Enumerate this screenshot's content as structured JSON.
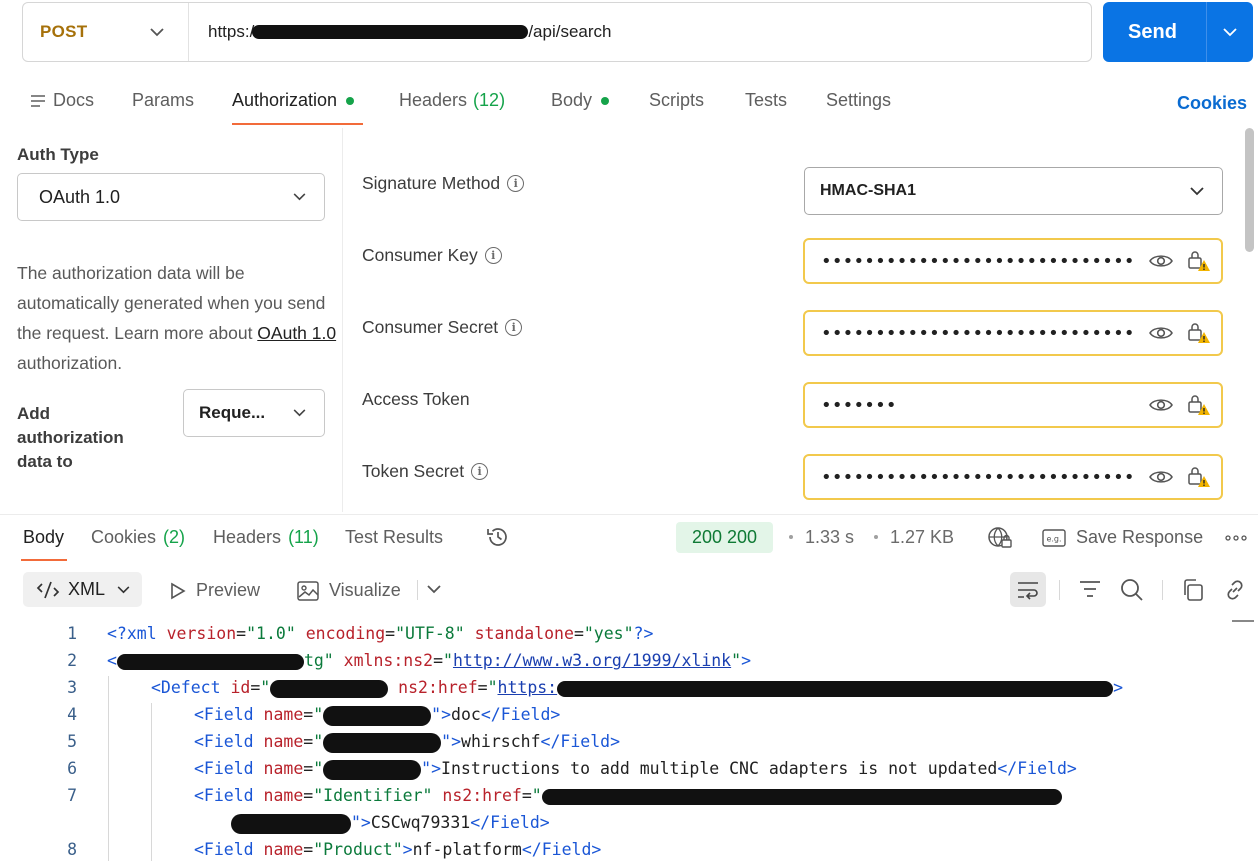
{
  "request": {
    "method": "POST",
    "url_prefix": "https:/",
    "url_suffix": "/api/search",
    "send_label": "Send"
  },
  "req_tabs": [
    {
      "label": "Docs"
    },
    {
      "label": "Params"
    },
    {
      "label": "Authorization"
    },
    {
      "label": "Headers",
      "count": "(12)"
    },
    {
      "label": "Body"
    },
    {
      "label": "Scripts"
    },
    {
      "label": "Tests"
    },
    {
      "label": "Settings"
    }
  ],
  "cookies_link": "Cookies",
  "auth": {
    "type_label": "Auth Type",
    "type_value": "OAuth 1.0",
    "desc_part1": "The authorization data will be automatically generated when you send the request. Learn more about ",
    "desc_link": "OAuth 1.0",
    "desc_part2": " authorization.",
    "add_label": "Add authorization data to",
    "add_value": "Reque..."
  },
  "fields": {
    "signature_method": {
      "label": "Signature Method",
      "value": "HMAC-SHA1"
    },
    "consumer_key": {
      "label": "Consumer Key",
      "value": "••••••••••••••••••••••••••••••••"
    },
    "consumer_secret": {
      "label": "Consumer Secret",
      "value": "••••••••••••••••••••••••••••••••"
    },
    "access_token": {
      "label": "Access Token",
      "value": "•••••••"
    },
    "token_secret": {
      "label": "Token Secret",
      "value": "••••••••••••••••••••••••••••••••"
    }
  },
  "resp_tabs": [
    {
      "label": "Body"
    },
    {
      "label": "Cookies",
      "count": "(2)"
    },
    {
      "label": "Headers",
      "count": "(11)"
    },
    {
      "label": "Test Results"
    }
  ],
  "response": {
    "status": "200 200",
    "time": "1.33 s",
    "size": "1.27 KB",
    "save_label": "Save Response",
    "format": "XML",
    "preview_label": "Preview",
    "visualize_label": "Visualize"
  },
  "code": {
    "l1": {
      "n": "1",
      "t1": "<?xml ",
      "a1": "version",
      "e1": "=",
      "v1": "\"1.0\"",
      "a2": " encoding",
      "e2": "=",
      "v2": "\"UTF-8\"",
      "a3": " standalone",
      "e3": "=",
      "v3": "\"yes\"",
      "t2": "?>"
    },
    "l2": {
      "n": "2",
      "t0": "<",
      "v1": "tg\"",
      "a1": " xmlns:ns2",
      "e1": "=",
      "v2": "\"",
      "link": "http://www.w3.org/1999/xlink",
      "v3": "\"",
      "t1": ">"
    },
    "l3": {
      "n": "3",
      "t0": "<Defect ",
      "a1": "id",
      "e1": "=",
      "v1": "\"",
      "a2": " ns2:href",
      "e2": "=",
      "v2": "\"",
      "link": "https:",
      "t1": ">"
    },
    "l4": {
      "n": "4",
      "t0": "<Field ",
      "a1": "name",
      "e1": "=",
      "v1": "\"",
      "t1": "\">",
      "body": "doc",
      "t2": "</Field>"
    },
    "l5": {
      "n": "5",
      "t0": "<Field ",
      "a1": "name",
      "e1": "=",
      "v1": "\"",
      "t1": "\">",
      "body": "whirschf",
      "t2": "</Field>"
    },
    "l6": {
      "n": "6",
      "t0": "<Field ",
      "a1": "name",
      "e1": "=",
      "v1": "\"",
      "t1": "\">",
      "body": "Instructions to add multiple CNC adapters is not updated",
      "t2": "</Field>"
    },
    "l7": {
      "n": "7",
      "t0": "<Field ",
      "a1": "name",
      "e1": "=",
      "v1": "\"Identifier\"",
      "a2": " ns2:href",
      "e2": "=",
      "v2": "\""
    },
    "l7b": {
      "t1": "\">",
      "body": "CSCwq79331",
      "t2": "</Field>"
    },
    "l8": {
      "n": "8",
      "t0": "<Field ",
      "a1": "name",
      "e1": "=",
      "v1": "\"Product\"",
      "t1": ">",
      "body": "nf-platform",
      "t2": "</Field>"
    }
  }
}
